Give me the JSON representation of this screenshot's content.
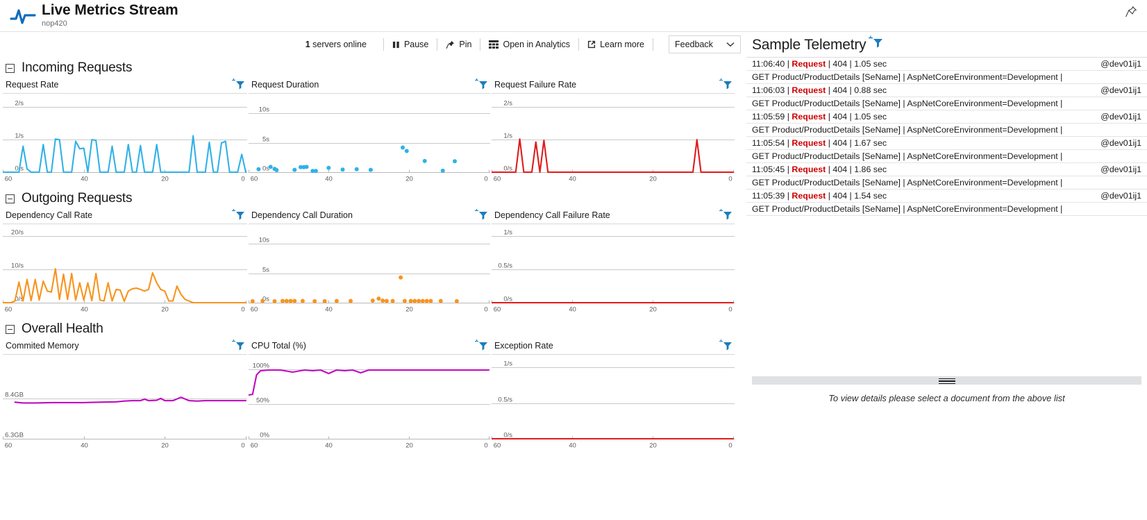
{
  "header": {
    "title": "Live Metrics Stream",
    "subtitle": "nop420",
    "pulse_icon": "pulse-icon",
    "pin_icon": "pin-icon"
  },
  "toolbar": {
    "servers_count": "1",
    "servers_label": " servers online",
    "pause_label": "Pause",
    "pin_label": "Pin",
    "analytics_label": "Open in Analytics",
    "learn_more_label": "Learn more",
    "feedback_label": "Feedback"
  },
  "sections": [
    {
      "title": "Incoming Requests"
    },
    {
      "title": "Outgoing Requests"
    },
    {
      "title": "Overall Health"
    }
  ],
  "telemetry": {
    "title": "Sample Telemetry",
    "rows": [
      {
        "time": "11:06:40",
        "kind": "Request",
        "code": "404",
        "duration": "1.05 sec",
        "server": "@dev01ij1",
        "detail": "GET Product/ProductDetails [SeName] | AspNetCoreEnvironment=Development |"
      },
      {
        "time": "11:06:03",
        "kind": "Request",
        "code": "404",
        "duration": "0.88 sec",
        "server": "@dev01ij1",
        "detail": "GET Product/ProductDetails [SeName] | AspNetCoreEnvironment=Development |"
      },
      {
        "time": "11:05:59",
        "kind": "Request",
        "code": "404",
        "duration": "1.05 sec",
        "server": "@dev01ij1",
        "detail": "GET Product/ProductDetails [SeName] | AspNetCoreEnvironment=Development |"
      },
      {
        "time": "11:05:54",
        "kind": "Request",
        "code": "404",
        "duration": "1.67 sec",
        "server": "@dev01ij1",
        "detail": "GET Product/ProductDetails [SeName] | AspNetCoreEnvironment=Development |"
      },
      {
        "time": "11:05:45",
        "kind": "Request",
        "code": "404",
        "duration": "1.86 sec",
        "server": "@dev01ij1",
        "detail": "GET Product/ProductDetails [SeName] | AspNetCoreEnvironment=Development |"
      },
      {
        "time": "11:05:39",
        "kind": "Request",
        "code": "404",
        "duration": "1.54 sec",
        "server": "@dev01ij1",
        "detail": "GET Product/ProductDetails [SeName] | AspNetCoreEnvironment=Development |"
      }
    ],
    "detail_placeholder": "To view details please select a document from the above list"
  },
  "colors": {
    "blue": "#30b1e8",
    "red": "#e01b1b",
    "orange": "#f7941e",
    "magenta": "#bf0bbf",
    "accent": "#0078d4",
    "grid": "#cfcfcf"
  },
  "chart_data": [
    {
      "type": "line",
      "title": "Request Rate",
      "ylabel": "",
      "xlabel": "",
      "yticks": [
        "0/s",
        "1/s",
        "2/s"
      ],
      "ytickvals": [
        0,
        1,
        2
      ],
      "ylim": [
        0,
        2.35
      ],
      "xticks": [
        "60",
        "40",
        "20",
        "0"
      ],
      "xlim": [
        60,
        0
      ],
      "color": "#30b1e8",
      "x": [
        60,
        59,
        58,
        57,
        56,
        55,
        54,
        53,
        52,
        51,
        50,
        49,
        48,
        47,
        46,
        45,
        44,
        43,
        42,
        41,
        40,
        39,
        38,
        37,
        36,
        35,
        34,
        33,
        32,
        31,
        30,
        29,
        28,
        27,
        26,
        25,
        24,
        23,
        22,
        21,
        20,
        19,
        18,
        17,
        16,
        15,
        14,
        13,
        12,
        11,
        10,
        9,
        8,
        7,
        6,
        5,
        4,
        3,
        2,
        1,
        0
      ],
      "values": [
        0,
        0,
        0,
        0,
        0,
        0.8,
        0.1,
        0,
        0,
        0,
        0.85,
        0,
        0,
        1.02,
        1.0,
        0,
        0,
        0,
        0.95,
        0.72,
        0.74,
        0,
        1.0,
        0.98,
        0,
        0,
        0,
        0.8,
        0,
        0,
        0,
        0.85,
        0,
        0,
        0.82,
        0,
        0,
        0,
        0.85,
        0,
        0,
        0,
        0,
        0,
        0,
        0,
        0,
        1.12,
        0,
        0,
        0,
        0.92,
        0,
        0,
        0.9,
        0.95,
        0,
        0,
        0,
        0.55,
        0
      ]
    },
    {
      "type": "scatter",
      "title": "Request Duration",
      "yticks": [
        "0s",
        "5s",
        "10s"
      ],
      "ytickvals": [
        0,
        5,
        10
      ],
      "ylim": [
        0,
        13
      ],
      "xticks": [
        "60",
        "40",
        "20",
        "0"
      ],
      "xlim": [
        60,
        0
      ],
      "color": "#30b1e8",
      "points": [
        [
          57.5,
          0.5
        ],
        [
          54.5,
          0.9
        ],
        [
          53.5,
          0.55
        ],
        [
          53.0,
          0.35
        ],
        [
          48.5,
          0.4
        ],
        [
          47.0,
          0.85
        ],
        [
          46.2,
          0.85
        ],
        [
          45.5,
          0.9
        ],
        [
          44.0,
          0.2
        ],
        [
          43.2,
          0.2
        ],
        [
          40.0,
          0.75
        ],
        [
          36.5,
          0.45
        ],
        [
          33.0,
          0.5
        ],
        [
          29.5,
          0.4
        ],
        [
          21.5,
          4.2
        ],
        [
          20.5,
          3.6
        ],
        [
          16.0,
          1.9
        ],
        [
          11.5,
          0.25
        ],
        [
          8.5,
          1.85
        ]
      ]
    },
    {
      "type": "line",
      "title": "Request Failure Rate",
      "yticks": [
        "0/s",
        "1/s",
        "2/s"
      ],
      "ytickvals": [
        0,
        1,
        2
      ],
      "ylim": [
        0,
        2.35
      ],
      "xticks": [
        "60",
        "40",
        "20",
        "0"
      ],
      "xlim": [
        60,
        0
      ],
      "color": "#e01b1b",
      "x": [
        60,
        57,
        55,
        54,
        53,
        52,
        51,
        50,
        49,
        48,
        47,
        46,
        45,
        44,
        10,
        9,
        8,
        7,
        0
      ],
      "values": [
        0,
        0,
        0,
        0,
        1.02,
        0,
        0,
        0,
        0.93,
        0,
        0.98,
        0,
        0,
        0,
        0,
        1.0,
        0,
        0,
        0
      ]
    },
    {
      "type": "line",
      "title": "Dependency Call Rate",
      "yticks": [
        "0/s",
        "10/s",
        "20/s"
      ],
      "ytickvals": [
        0,
        10,
        20
      ],
      "ylim": [
        0,
        23
      ],
      "xticks": [
        "60",
        "40",
        "20",
        "0"
      ],
      "xlim": [
        60,
        0
      ],
      "color": "#f7941e",
      "x": [
        60,
        59,
        58,
        57,
        56,
        55,
        54,
        53,
        52,
        51,
        50,
        49,
        48,
        47,
        46,
        45,
        44,
        43,
        42,
        41,
        40,
        39,
        38,
        37,
        36,
        35,
        34,
        33,
        32,
        31,
        30,
        29,
        28,
        27,
        26,
        25,
        24,
        23,
        22,
        21,
        20,
        19,
        18,
        17,
        16,
        15,
        14,
        13,
        12,
        11,
        10,
        9,
        8,
        7,
        6,
        5,
        4,
        3,
        2,
        1,
        0
      ],
      "values": [
        0,
        0,
        0,
        0.5,
        6.2,
        0.5,
        7.0,
        0.6,
        7.0,
        0.8,
        6.5,
        3.5,
        3.2,
        10.2,
        1.0,
        8.6,
        1.0,
        8.8,
        0.8,
        6.0,
        0.8,
        6.0,
        0.6,
        8.8,
        0.8,
        0.5,
        6.0,
        0.5,
        4.0,
        3.8,
        0.4,
        3.5,
        4.2,
        4.4,
        4.0,
        3.5,
        4.0,
        9.0,
        6.0,
        4.0,
        3.5,
        0.5,
        0.5,
        5.0,
        2.5,
        1.0,
        0.5,
        0,
        0,
        0,
        0,
        0,
        0,
        0,
        0,
        0,
        0,
        0,
        0,
        0,
        0
      ]
    },
    {
      "type": "scatter",
      "title": "Dependency Call Duration",
      "yticks": [
        "0s",
        "5s",
        "10s"
      ],
      "ytickvals": [
        0,
        5,
        10
      ],
      "ylim": [
        0,
        13
      ],
      "xticks": [
        "60",
        "40",
        "20",
        "0"
      ],
      "xlim": [
        60,
        0
      ],
      "color": "#f7941e",
      "points": [
        [
          59.0,
          0.25
        ],
        [
          56.5,
          0.3
        ],
        [
          53.5,
          0.25
        ],
        [
          51.5,
          0.3
        ],
        [
          50.5,
          0.3
        ],
        [
          49.5,
          0.3
        ],
        [
          48.5,
          0.3
        ],
        [
          46.5,
          0.3
        ],
        [
          43.5,
          0.25
        ],
        [
          41.0,
          0.25
        ],
        [
          38.0,
          0.3
        ],
        [
          34.5,
          0.3
        ],
        [
          29.0,
          0.35
        ],
        [
          27.5,
          0.7
        ],
        [
          26.5,
          0.35
        ],
        [
          25.5,
          0.3
        ],
        [
          24.0,
          0.3
        ],
        [
          22.0,
          4.3
        ],
        [
          21.0,
          0.3
        ],
        [
          19.5,
          0.3
        ],
        [
          18.5,
          0.3
        ],
        [
          17.5,
          0.3
        ],
        [
          16.5,
          0.3
        ],
        [
          15.5,
          0.3
        ],
        [
          14.5,
          0.3
        ],
        [
          12.0,
          0.3
        ],
        [
          8.0,
          0.25
        ]
      ]
    },
    {
      "type": "line",
      "title": "Dependency Call Failure Rate",
      "yticks": [
        "0/s",
        "0.5/s",
        "1/s"
      ],
      "ytickvals": [
        0,
        0.5,
        1
      ],
      "ylim": [
        0,
        1.15
      ],
      "xticks": [
        "60",
        "40",
        "20",
        "0"
      ],
      "xlim": [
        60,
        0
      ],
      "color": "#e01b1b",
      "x": [
        60,
        0
      ],
      "values": [
        0,
        0
      ]
    },
    {
      "type": "line",
      "title": "Commited Memory",
      "yticks": [
        "6.3GB",
        "8.4GB"
      ],
      "ytickvals": [
        6.3,
        8.4
      ],
      "ylim": [
        6.3,
        10.6
      ],
      "xticks": [
        "60",
        "40",
        "20",
        "0"
      ],
      "xlim": [
        60,
        0
      ],
      "color": "#bf0bbf",
      "x": [
        57,
        55,
        52,
        48,
        44,
        40,
        36,
        32,
        30,
        28,
        26,
        25,
        24,
        22,
        21,
        20,
        18,
        16,
        14,
        12,
        10,
        8,
        6,
        4,
        2,
        0
      ],
      "values": [
        8.22,
        8.18,
        8.18,
        8.2,
        8.2,
        8.2,
        8.22,
        8.24,
        8.28,
        8.3,
        8.3,
        8.38,
        8.3,
        8.32,
        8.42,
        8.3,
        8.3,
        8.48,
        8.3,
        8.28,
        8.3,
        8.3,
        8.3,
        8.3,
        8.3,
        8.3
      ]
    },
    {
      "type": "line",
      "title": "CPU Total (%)",
      "yticks": [
        "0%",
        "50%",
        "100%"
      ],
      "ytickvals": [
        0,
        50,
        100
      ],
      "ylim": [
        0,
        118
      ],
      "xticks": [
        "60",
        "40",
        "20",
        "0"
      ],
      "xlim": [
        60,
        0
      ],
      "color": "#bf0bbf",
      "x": [
        60,
        59,
        58,
        57,
        55,
        52,
        49,
        46,
        44,
        42,
        40,
        38,
        36,
        34,
        32,
        30,
        28,
        26,
        24,
        22,
        20,
        18,
        16,
        14,
        12,
        10,
        8,
        6,
        4,
        2,
        0
      ],
      "values": [
        63,
        64,
        92,
        98,
        99,
        99,
        96,
        99,
        98,
        99,
        94,
        99,
        98,
        99,
        95,
        99,
        99,
        99,
        99,
        99,
        99,
        99,
        99,
        99,
        99,
        99,
        99,
        99,
        99,
        99,
        99
      ]
    },
    {
      "type": "line",
      "title": "Exception Rate",
      "yticks": [
        "0/s",
        "0.5/s",
        "1/s"
      ],
      "ytickvals": [
        0,
        0.5,
        1
      ],
      "ylim": [
        0,
        1.15
      ],
      "xticks": [
        "60",
        "40",
        "20",
        "0"
      ],
      "xlim": [
        60,
        0
      ],
      "color": "#e01b1b",
      "x": [
        60,
        0
      ],
      "values": [
        0,
        0
      ]
    }
  ]
}
